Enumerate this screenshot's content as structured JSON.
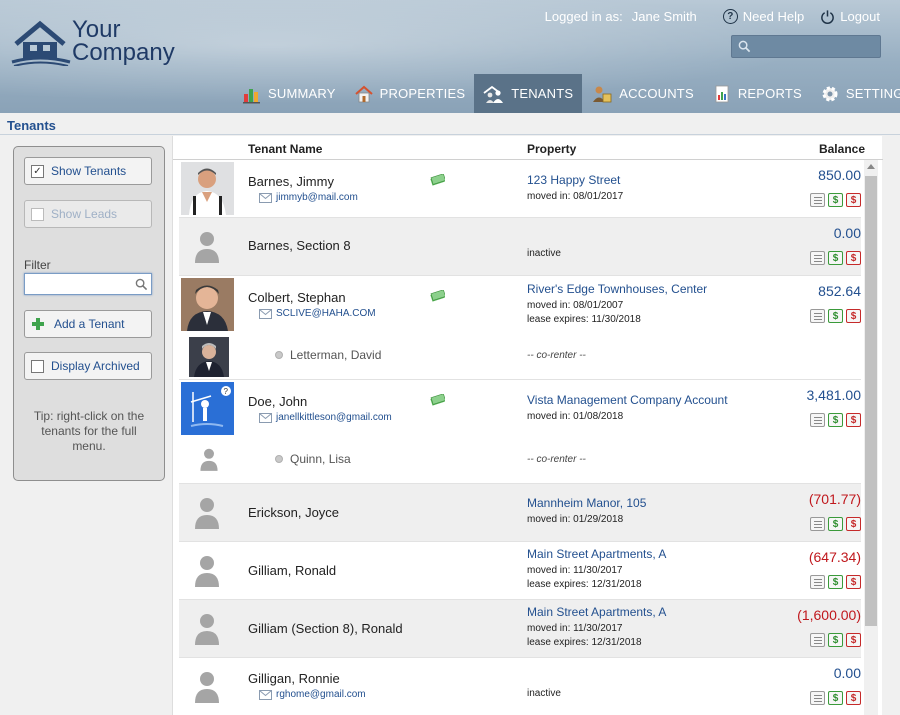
{
  "brand": {
    "line1": "Your",
    "line2": "Company"
  },
  "topbar": {
    "logged_in_label": "Logged in as:",
    "user_name": "Jane Smith",
    "help_label": "Need Help",
    "logout_label": "Logout"
  },
  "search": {
    "placeholder": ""
  },
  "nav": {
    "tabs": [
      {
        "label": "SUMMARY",
        "icon": "bar-chart-icon"
      },
      {
        "label": "PROPERTIES",
        "icon": "house-icon"
      },
      {
        "label": "TENANTS",
        "icon": "tenants-icon",
        "active": true
      },
      {
        "label": "ACCOUNTS",
        "icon": "accounts-icon"
      },
      {
        "label": "REPORTS",
        "icon": "report-icon"
      },
      {
        "label": "SETTINGS",
        "icon": "gear-icon"
      }
    ]
  },
  "page": {
    "title": "Tenants"
  },
  "sidebar": {
    "show_tenants": "Show Tenants",
    "show_leads": "Show Leads",
    "filter_label": "Filter",
    "filter_value": "",
    "add_tenant": "Add a Tenant",
    "display_archived": "Display Archived",
    "tip": "Tip: right-click on the tenants for the full menu."
  },
  "table": {
    "headers": {
      "name": "Tenant Name",
      "property": "Property",
      "balance": "Balance"
    },
    "rows": [
      {
        "name": "Barnes, Jimmy",
        "email": "jimmyb@mail.com",
        "property": "123 Happy Street",
        "moved_in": "moved in: 08/01/2017",
        "balance": "850.00"
      },
      {
        "name": "Barnes, Section 8",
        "status": "inactive",
        "balance": "0.00"
      },
      {
        "name": "Colbert, Stephan",
        "email": "SCLIVE@HAHA.COM",
        "property": "River's Edge Townhouses, Center",
        "moved_in": "moved in: 08/01/2007",
        "lease": "lease expires: 11/30/2018",
        "balance": "852.64",
        "corenter": "Letterman, David",
        "corenter_note": "-- co-renter --"
      },
      {
        "name": "Doe, John",
        "email": "janellkittleson@gmail.com",
        "property": "Vista Management Company Account",
        "moved_in": "moved in: 01/08/2018",
        "balance": "3,481.00",
        "corenter": "Quinn, Lisa",
        "corenter_note": "-- co-renter --"
      },
      {
        "name": "Erickson, Joyce",
        "property": "Mannheim Manor, 105",
        "moved_in": "moved in: 01/29/2018",
        "balance": "(701.77)"
      },
      {
        "name": "Gilliam, Ronald",
        "property": "Main Street Apartments, A",
        "moved_in": "moved in: 11/30/2017",
        "lease": "lease expires: 12/31/2018",
        "balance": "(647.34)"
      },
      {
        "name": "Gilliam (Section 8), Ronald",
        "property": "Main Street Apartments, A",
        "moved_in": "moved in: 11/30/2017",
        "lease": "lease expires: 12/31/2018",
        "balance": "(1,600.00)"
      },
      {
        "name": "Gilligan, Ronnie",
        "email": "rghome@gmail.com",
        "status": "inactive",
        "balance": "0.00"
      }
    ]
  },
  "colors": {
    "link": "#23508f",
    "negative": "#c0181d",
    "header_bg": "#98afc2",
    "active_tab": "#5a7288"
  }
}
